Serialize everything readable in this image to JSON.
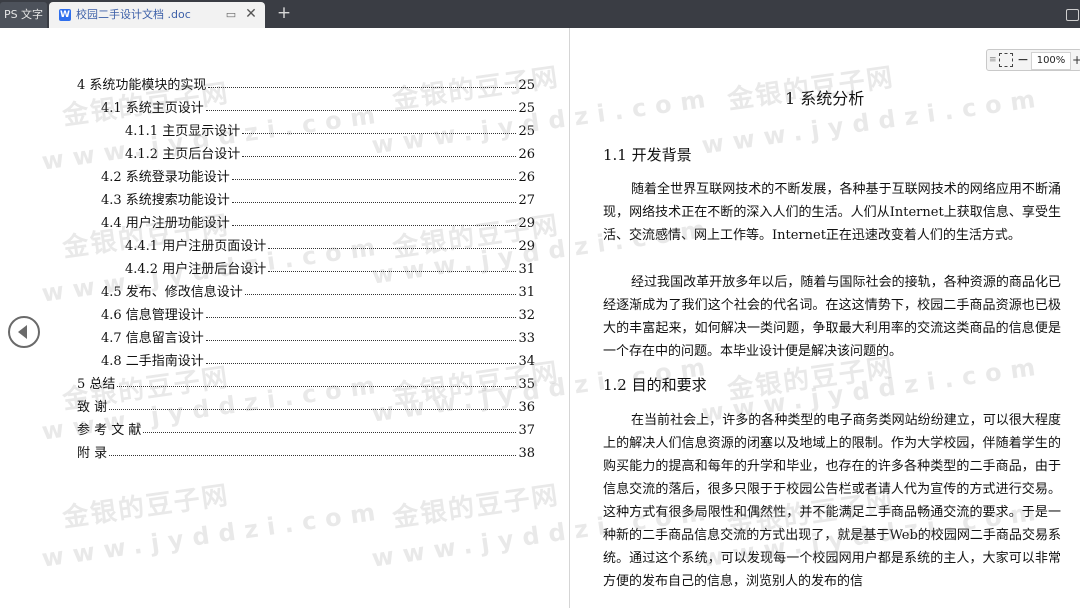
{
  "tabs": {
    "app_label": "PS 文字",
    "doc_label": "校园二手设计文档 .doc",
    "doc_icon_letter": "W"
  },
  "toc": [
    {
      "label": "4 系统功能模块的实现",
      "page": "25"
    },
    {
      "label": "4.1 系统主页设计",
      "page": "25"
    },
    {
      "label": "4.1.1 主页显示设计",
      "page": "25"
    },
    {
      "label": "4.1.2 主页后台设计",
      "page": "26"
    },
    {
      "label": "4.2 系统登录功能设计",
      "page": "26"
    },
    {
      "label": "4.3 系统搜索功能设计",
      "page": "27"
    },
    {
      "label": "4.4 用户注册功能设计",
      "page": "29"
    },
    {
      "label": "4.4.1 用户注册页面设计",
      "page": "29"
    },
    {
      "label": "4.4.2 用户注册后台设计",
      "page": "31"
    },
    {
      "label": "4.5 发布、修改信息设计",
      "page": "31"
    },
    {
      "label": "4.6 信息管理设计",
      "page": "32"
    },
    {
      "label": "4.7 信息留言设计",
      "page": "33"
    },
    {
      "label": "4.8 二手指南设计",
      "page": "34"
    },
    {
      "label": "5 总结",
      "page": "35"
    },
    {
      "label": "致 谢",
      "page": "36"
    },
    {
      "label": "参 考 文 献",
      "page": "37"
    },
    {
      "label": "附 录",
      "page": "38"
    }
  ],
  "zoom": {
    "value": "100%",
    "minus": "−",
    "plus": "+"
  },
  "document": {
    "chapter_title": "1 系统分析",
    "section1_title": "1.1 开发背景",
    "para1": "随着全世界互联网技术的不断发展，各种基于互联网技术的网络应用不断涌现，网络技术正在不断的深入人们的生活。人们从Internet上获取信息、享受生活、交流感情、网上工作等。Internet正在迅速改变着人们的生活方式。",
    "para2": "经过我国改革开放多年以后，随着与国际社会的接轨，各种资源的商品化已经逐渐成为了我们这个社会的代名词。在这这情势下，校园二手商品资源也已极大的丰富起来，如何解决一类问题，争取最大利用率的交流这类商品的信息便是一个存在中的问题。本毕业设计便是解决该问题的。",
    "section2_title": "1.2 目的和要求",
    "para3": "在当前社会上，许多的各种类型的电子商务类网站纷纷建立，可以很大程度上的解决人们信息资源的闭塞以及地域上的限制。作为大学校园，伴随着学生的购买能力的提高和每年的升学和毕业，也存在的许多各种类型的二手商品，由于信息交流的落后，很多只限于于校园公告栏或者请人代为宣传的方式进行交易。这种方式有很多局限性和偶然性，并不能满足二手商品畅通交流的要求。于是一种新的二手商品信息交流的方式出现了，就是基于Web的校园网二手商品交易系统。通过这个系统，可以发现每一个校园网用户都是系统的主人，大家可以非常方便的发布自己的信息，浏览别人的发布的信"
  },
  "watermark": {
    "name": "金银的豆子网",
    "url": "www.jyddzi.com"
  }
}
